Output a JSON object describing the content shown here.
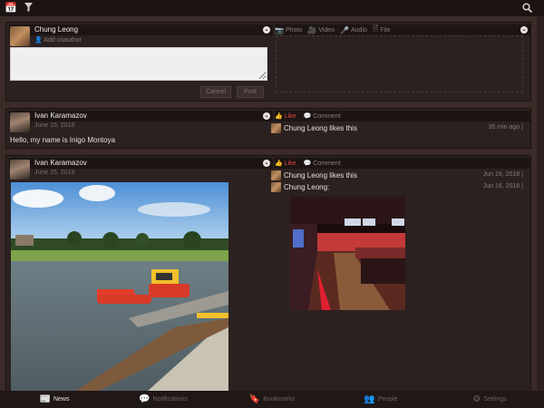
{
  "topbar": {
    "calendar_icon": "calendar-icon",
    "filter_icon": "filter-icon",
    "search_icon": "search-icon"
  },
  "composer": {
    "user_name": "Chung Leong",
    "add_coauthor": "Add coauthor",
    "tabs": [
      {
        "icon": "camera-icon",
        "label": "Photo"
      },
      {
        "icon": "video-icon",
        "label": "Video"
      },
      {
        "icon": "microphone-icon",
        "label": "Audio"
      },
      {
        "icon": "file-icon",
        "label": "File"
      }
    ],
    "textarea_value": "",
    "cancel_label": "Cancel",
    "post_label": "Post"
  },
  "posts": [
    {
      "author": "Ivan Karamazov",
      "date": "June 15, 2018",
      "text": "Hello, my name is Inigo Montoya",
      "like_label": "Like",
      "comment_label": "Comment",
      "reactions": [
        {
          "user": "Chung Leong",
          "text": "Chung Leong likes this",
          "time": "35 min ago"
        }
      ]
    },
    {
      "author": "Ivan Karamazov",
      "date": "June 15, 2018",
      "like_label": "Like",
      "comment_label": "Comment",
      "reactions": [
        {
          "user": "Chung Leong",
          "text": "Chung Leong likes this",
          "time": "Jun 16, 2018"
        },
        {
          "user": "Chung Leong",
          "text": "Chung Leong:",
          "time": "Jun 16, 2018"
        }
      ]
    }
  ],
  "bottom_tabs": [
    {
      "icon": "news-icon",
      "label": "News",
      "active": true
    },
    {
      "icon": "notifications-icon",
      "label": "Notifications",
      "active": false
    },
    {
      "icon": "bookmark-icon",
      "label": "Bookmarks",
      "active": false
    },
    {
      "icon": "people-icon",
      "label": "People",
      "active": false
    },
    {
      "icon": "settings-icon",
      "label": "Settings",
      "active": false
    }
  ],
  "colors": {
    "background": "#3a2b28",
    "panel": "#2b2120",
    "header_bar": "#1c1514",
    "accent_red": "#e04a3a"
  }
}
